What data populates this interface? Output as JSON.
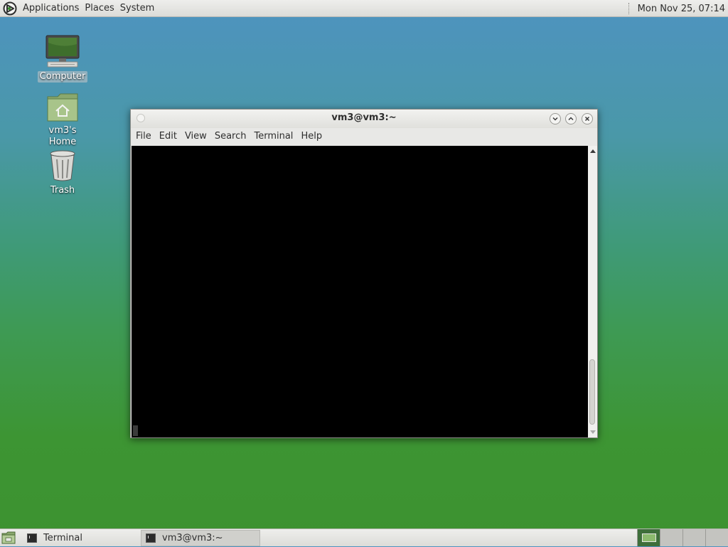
{
  "top_panel": {
    "menus": [
      "Applications",
      "Places",
      "System"
    ],
    "clock": "Mon Nov 25, 07:14"
  },
  "desktop": {
    "icons": [
      {
        "label": "Computer",
        "icon": "computer-icon",
        "selected": true
      },
      {
        "label": "vm3's Home",
        "icon": "home-folder-icon",
        "selected": false
      },
      {
        "label": "Trash",
        "icon": "trash-icon",
        "selected": false
      }
    ]
  },
  "window": {
    "title": "vm3@vm3:~",
    "menus": [
      "File",
      "Edit",
      "View",
      "Search",
      "Terminal",
      "Help"
    ],
    "terminal_background": "#000000"
  },
  "bottom_panel": {
    "tasks": [
      {
        "label": "Terminal",
        "icon": "terminal-icon",
        "active": false
      },
      {
        "label": "vm3@vm3:~",
        "icon": "terminal-icon",
        "active": true
      }
    ],
    "workspaces": 4,
    "current_workspace": 1
  },
  "colors": {
    "desktop_top": "#4e93c0",
    "desktop_bottom": "#3d9230",
    "panel": "#e4e4e0",
    "terminal_bg": "#000000"
  }
}
